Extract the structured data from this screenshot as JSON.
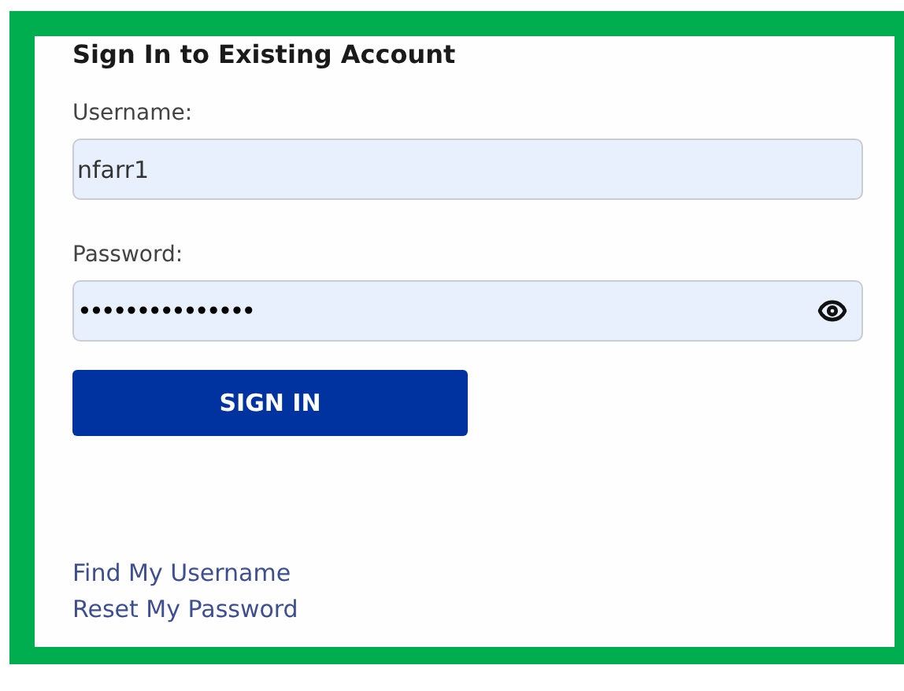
{
  "title": "Sign In to Existing Account",
  "fields": [
    {
      "label": "Username:",
      "value": "nfarr1",
      "kind": "text"
    },
    {
      "label": "Password:",
      "value": "•••••••••••••••",
      "kind": "password"
    }
  ],
  "button": "SIGN IN",
  "links": [
    "Find My Username",
    "Reset My Password"
  ]
}
